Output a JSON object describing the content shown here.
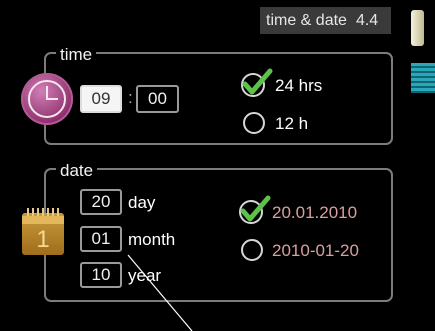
{
  "header": {
    "title": "time & date",
    "menu_number": "4.4"
  },
  "time": {
    "legend": "time",
    "hours": "09",
    "separator": ":",
    "minutes": "00",
    "formats": [
      {
        "label": "24 hrs",
        "selected": true
      },
      {
        "label": "12 h",
        "selected": false
      }
    ]
  },
  "date": {
    "legend": "date",
    "fields": [
      {
        "value": "20",
        "label": "day"
      },
      {
        "value": "01",
        "label": "month"
      },
      {
        "value": "10",
        "label": "year"
      }
    ],
    "calendar_icon_digit": "1",
    "formats": [
      {
        "label": "20.01.2010",
        "selected": true
      },
      {
        "label": "2010-01-20",
        "selected": false
      }
    ]
  },
  "colors": {
    "accent_green": "#5cc24a",
    "panel_border": "#7c7c7c",
    "clock_purple": "#a0407f",
    "calendar_gold": "#c89b3c",
    "side_tab_teal": "#28a8b8"
  },
  "icons": [
    "clock-icon",
    "calendar-icon",
    "checkmark-icon",
    "radio-empty-icon"
  ]
}
